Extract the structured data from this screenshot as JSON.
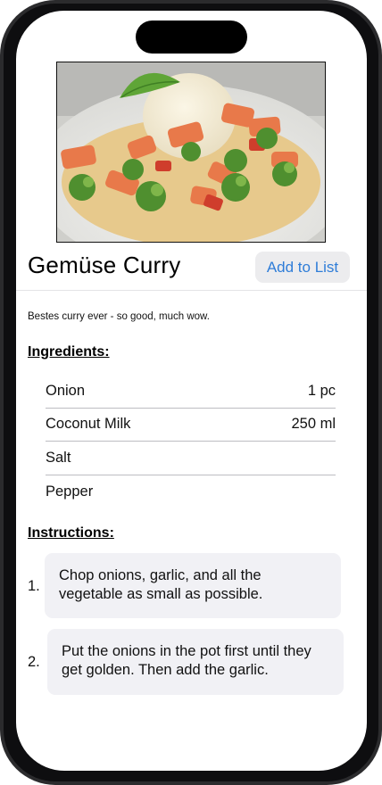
{
  "recipe": {
    "title": "Gemüse Curry",
    "add_button_label": "Add to List",
    "description": "Bestes curry ever - so good, much wow.",
    "ingredients_heading": "Ingredients:",
    "instructions_heading": "Instructions:",
    "ingredients": [
      {
        "name": "Onion",
        "amount": "1 pc"
      },
      {
        "name": "Coconut Milk",
        "amount": "250 ml"
      },
      {
        "name": "Salt",
        "amount": ""
      },
      {
        "name": "Pepper",
        "amount": ""
      }
    ],
    "instructions": [
      {
        "number": "1.",
        "text": "Chop onions, garlic, and all the vegetable as small as possible."
      },
      {
        "number": "2.",
        "text": "Put the onions in the pot first until they get golden. Then add the garlic."
      }
    ]
  },
  "colors": {
    "accent": "#2f7dd8",
    "button_bg": "#ececee",
    "card_bg": "#f1f1f5"
  }
}
